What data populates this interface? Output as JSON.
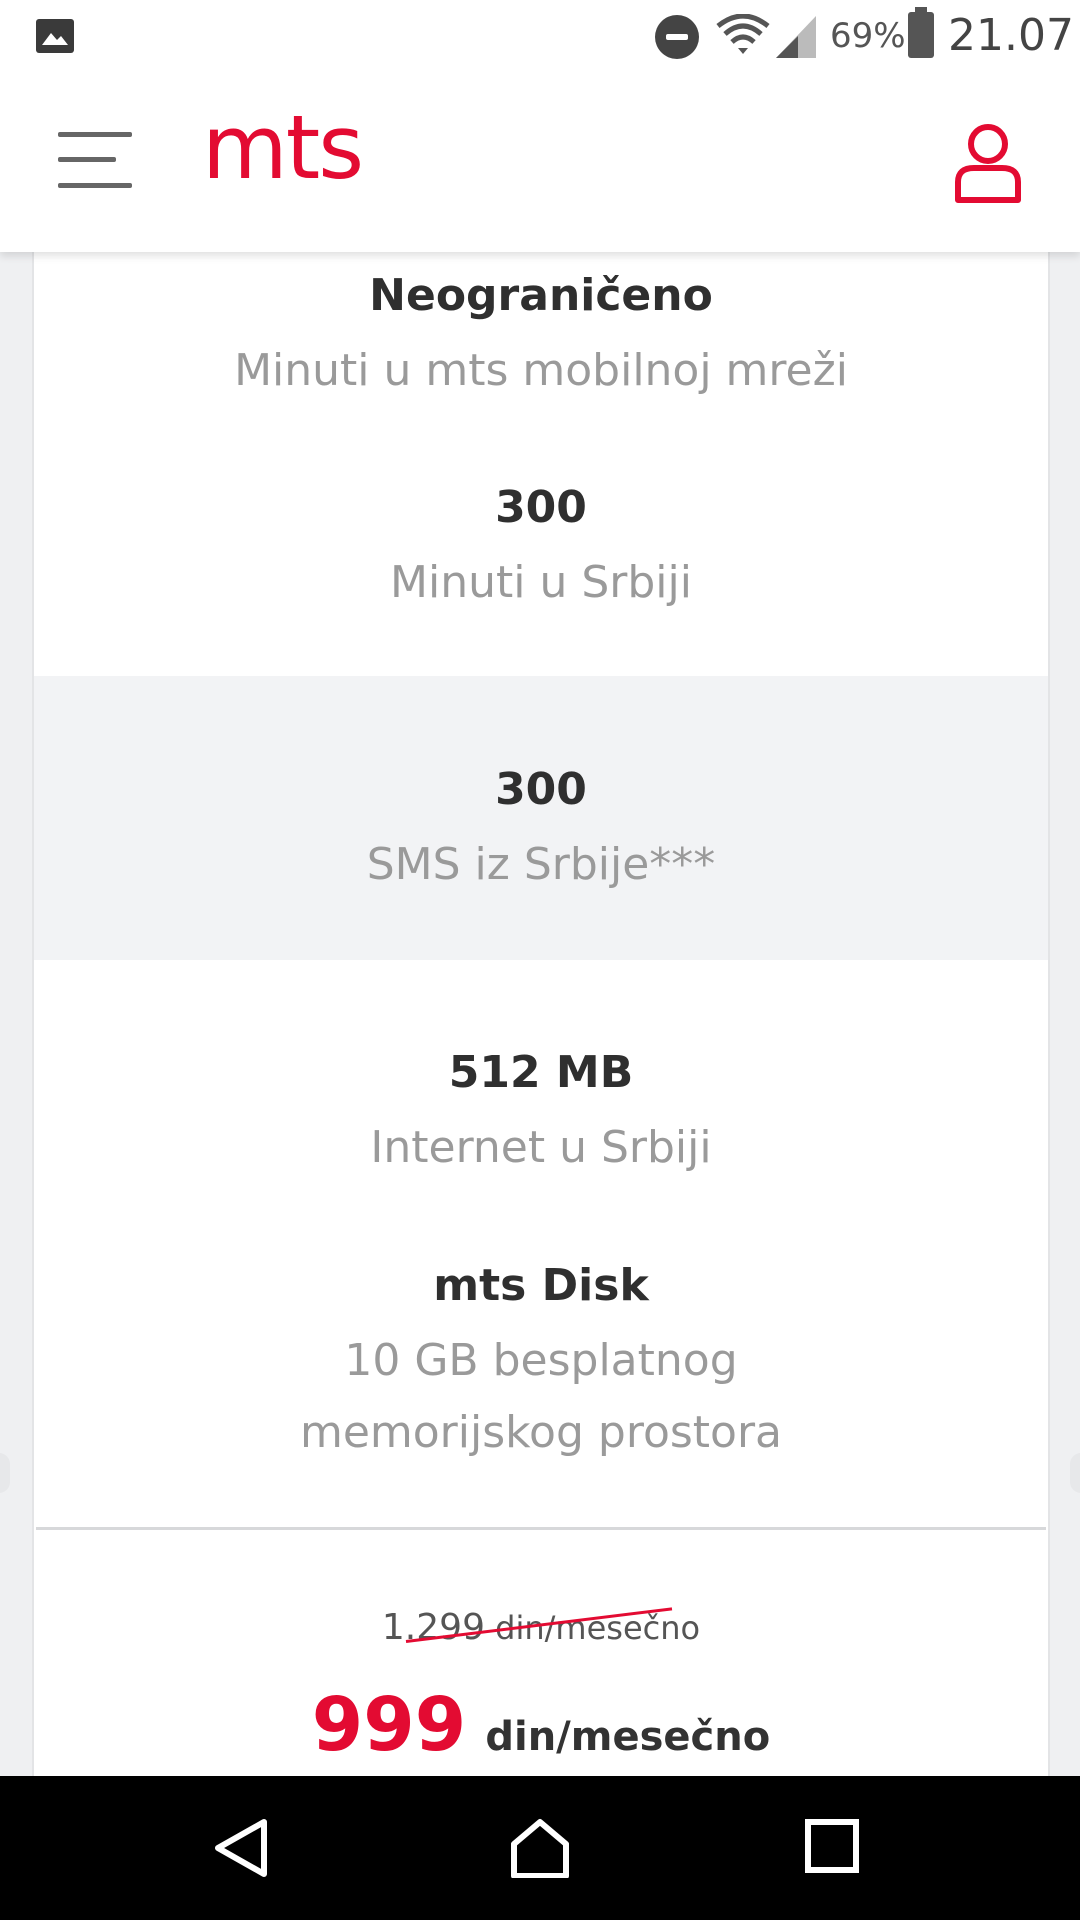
{
  "status_bar": {
    "battery": "69%",
    "time": "21.07",
    "icons": [
      "image-notification-icon",
      "do-not-disturb-icon",
      "wifi-icon",
      "cell-signal-icon",
      "battery-icon"
    ]
  },
  "header": {
    "logo": "mts",
    "menu_icon": "hamburger-menu-icon",
    "account_icon": "user-account-icon"
  },
  "plan": {
    "features": [
      {
        "value": "Neograničeno",
        "label": "Minuti u mts mobilnoj mreži"
      },
      {
        "value": "300",
        "label": "Minuti u Srbiji"
      },
      {
        "value": "300",
        "label": "SMS iz Srbije***"
      },
      {
        "value": "512 MB",
        "label": "Internet u Srbiji"
      },
      {
        "value": "mts Disk",
        "label": "10 GB besplatnog memorijskog prostora"
      }
    ],
    "old_price": "1.299",
    "old_price_unit": "din/mesečno",
    "new_price": "999",
    "new_price_unit": "din/mesečno"
  },
  "colors": {
    "brand": "#e30b32",
    "background": "#eff0f2"
  },
  "navigation_bar": [
    "back-icon",
    "home-icon",
    "recents-icon"
  ]
}
